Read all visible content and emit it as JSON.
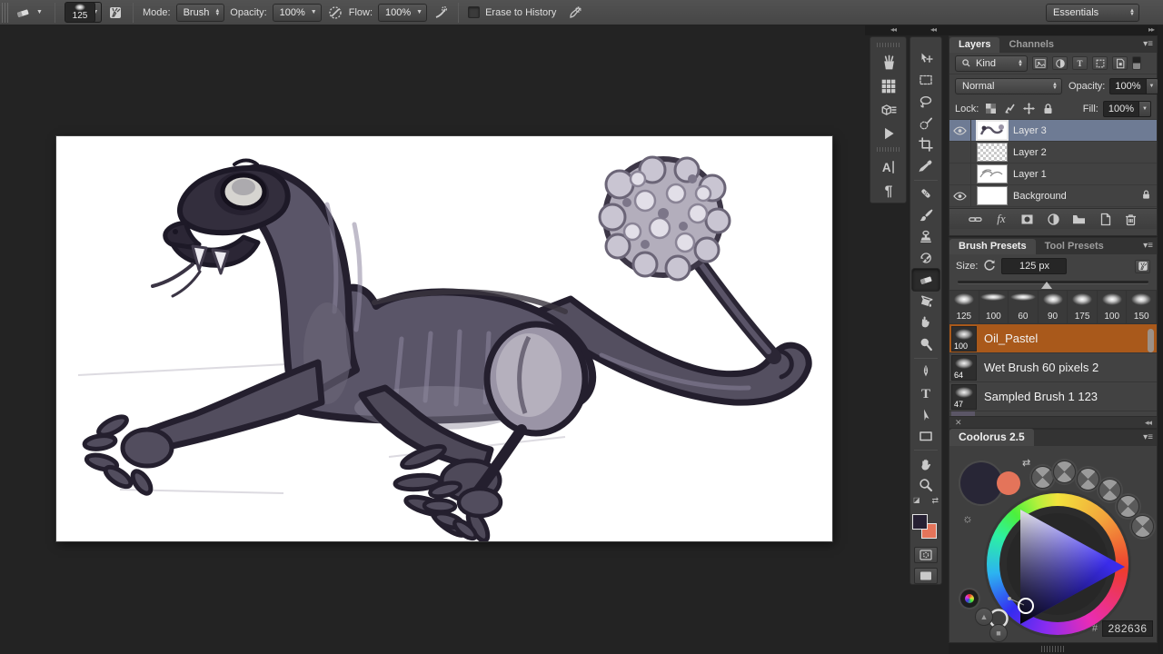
{
  "options_bar": {
    "tool": "eraser",
    "brush_size": "125",
    "mode_label": "Mode:",
    "mode_value": "Brush",
    "opacity_label": "Opacity:",
    "opacity_value": "100%",
    "flow_label": "Flow:",
    "flow_value": "100%",
    "erase_to_history_label": "Erase to History",
    "erase_to_history_checked": false,
    "workspace_selector": "Essentials"
  },
  "tools": [
    {
      "name": "move",
      "selected": false
    },
    {
      "name": "rectangular-marquee",
      "selected": false
    },
    {
      "name": "lasso",
      "selected": false
    },
    {
      "name": "quick-selection",
      "selected": false
    },
    {
      "name": "crop",
      "selected": false
    },
    {
      "name": "eyedropper",
      "selected": false
    },
    {
      "name": "spot-healing",
      "selected": false
    },
    {
      "name": "brush",
      "selected": false
    },
    {
      "name": "clone-stamp",
      "selected": false
    },
    {
      "name": "history-brush",
      "selected": false
    },
    {
      "name": "eraser",
      "selected": true
    },
    {
      "name": "gradient",
      "selected": false
    },
    {
      "name": "smudge",
      "selected": false
    },
    {
      "name": "dodge",
      "selected": false
    },
    {
      "name": "pen",
      "selected": false
    },
    {
      "name": "type",
      "selected": false
    },
    {
      "name": "path-selection",
      "selected": false
    },
    {
      "name": "rectangle",
      "selected": false
    },
    {
      "name": "hand",
      "selected": false
    },
    {
      "name": "zoom",
      "selected": false
    }
  ],
  "icon_dock": [
    "brush-presets",
    "swatches",
    "styles",
    "actions",
    "character",
    "paragraph"
  ],
  "toolbar_colors": {
    "foreground": "#262033",
    "background": "#e4745a"
  },
  "layers_panel": {
    "tabs": [
      "Layers",
      "Channels"
    ],
    "active_tab": "Layers",
    "kind_filter": "Kind",
    "blend_mode": "Normal",
    "opacity_label": "Opacity:",
    "opacity_value": "100%",
    "lock_label": "Lock:",
    "fill_label": "Fill:",
    "fill_value": "100%",
    "layers": [
      {
        "name": "Layer 3",
        "visible": true,
        "selected": true,
        "locked": false,
        "thumb": "artwork"
      },
      {
        "name": "Layer 2",
        "visible": false,
        "selected": false,
        "locked": false,
        "thumb": "transparent"
      },
      {
        "name": "Layer 1",
        "visible": false,
        "selected": false,
        "locked": false,
        "thumb": "sketch"
      },
      {
        "name": "Background",
        "visible": true,
        "selected": false,
        "locked": true,
        "thumb": "white"
      }
    ]
  },
  "brush_panel": {
    "tabs": [
      "Brush Presets",
      "Tool Presets"
    ],
    "active_tab": "Brush Presets",
    "size_label": "Size:",
    "size_value": "125 px",
    "brush_sizes": [
      "125",
      "100",
      "60",
      "90",
      "175",
      "100",
      "150"
    ],
    "presets": [
      {
        "name": "Oil_Pastel",
        "size": "100",
        "selected": true
      },
      {
        "name": "Wet Brush 60 pixels 2",
        "size": "64",
        "selected": false
      },
      {
        "name": "Sampled Brush 1 123",
        "size": "47",
        "selected": false
      }
    ]
  },
  "coolorus": {
    "title": "Coolorus 2.5",
    "hex_label": "#",
    "hex_value": "282636",
    "foreground_color": "#282636",
    "background_color": "#e4745a",
    "knob_count": 6
  },
  "colors": {
    "selected_layer_row": "#6e7b94",
    "selected_preset_row": "#a9591b",
    "options_bar_bg": "#4a4a4a",
    "workspace_bg": "#232323"
  }
}
